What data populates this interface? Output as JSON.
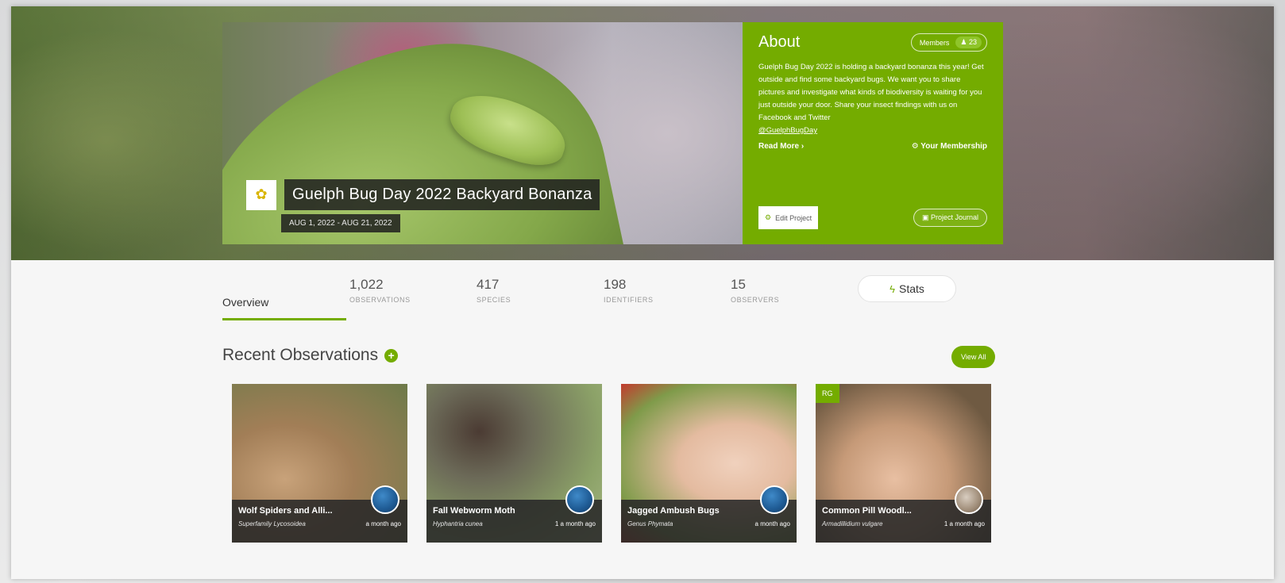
{
  "project": {
    "title": "Guelph Bug Day 2022 Backyard Bonanza",
    "dates": "AUG 1, 2022 - AUG 21, 2022",
    "logo_icon": "bug-logo-icon"
  },
  "about": {
    "title": "About",
    "members_label": "Members",
    "members_count": "23",
    "description": "Guelph Bug Day 2022 is holding a backyard bonanza this year! Get outside and find some backyard bugs. We want you to share pictures and investigate what kinds of biodiversity is waiting for you just outside your door. Share your insect findings with us on Facebook and Twitter",
    "handle": "@GuelphBugDay",
    "read_more": "Read More ›",
    "your_membership": "Your Membership",
    "edit_project": "Edit Project",
    "project_journal": "Project Journal",
    "accent_color": "#74ac00"
  },
  "stats": {
    "overview_tab": "Overview",
    "observations": {
      "value": "1,022",
      "label": "OBSERVATIONS"
    },
    "species": {
      "value": "417",
      "label": "SPECIES"
    },
    "identifiers": {
      "value": "198",
      "label": "IDENTIFIERS"
    },
    "observers": {
      "value": "15",
      "label": "OBSERVERS"
    },
    "stats_button": "Stats"
  },
  "recent": {
    "title": "Recent Observations",
    "view_all": "View All",
    "cards": [
      {
        "name": "Wolf Spiders and Alli...",
        "sci": "Superfamily Lycosoidea",
        "time": "a month ago",
        "badge": ""
      },
      {
        "name": "Fall Webworm Moth",
        "sci": "Hyphantria cunea",
        "time": "1 a month ago",
        "badge": ""
      },
      {
        "name": "Jagged Ambush Bugs",
        "sci": "Genus Phymata",
        "time": "a month ago",
        "badge": ""
      },
      {
        "name": "Common Pill Woodl...",
        "sci": "Armadillidium vulgare",
        "time": "1 a month ago",
        "badge": "RG"
      }
    ]
  }
}
